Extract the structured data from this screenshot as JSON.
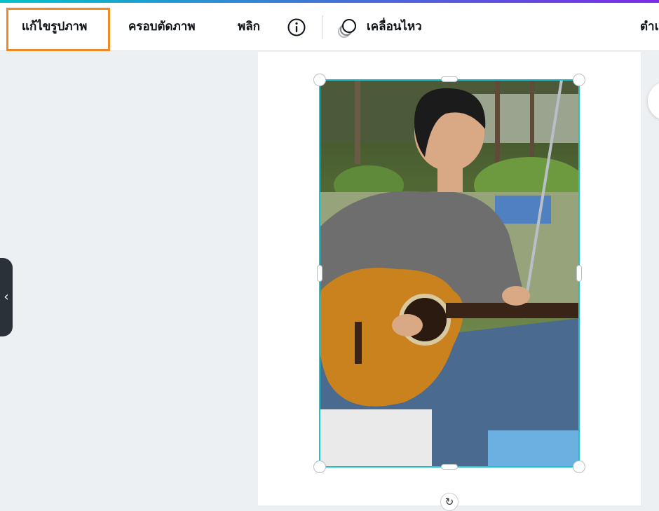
{
  "toolbar": {
    "edit_image": "แก้ไขรูปภาพ",
    "crop_image": "ครอบตัดภาพ",
    "flip": "พลิก",
    "animate": "เคลื่อนไหว",
    "position": "ตำแ"
  },
  "sidebar": {
    "collapse_glyph": "‹"
  },
  "canvas": {
    "rotate_glyph": "↻"
  },
  "colors": {
    "highlight": "#f08a24",
    "selection": "#20c4cb",
    "gradient_start": "#00c4cc",
    "gradient_end": "#7d2ae8"
  }
}
